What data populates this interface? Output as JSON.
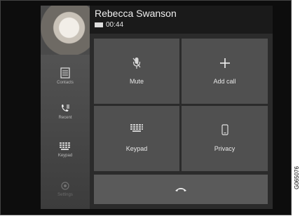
{
  "caller": {
    "name": "Rebecca Swanson",
    "call_time": "00:44"
  },
  "sidebar": {
    "items": [
      {
        "label": "Contacts",
        "icon": "contacts-icon"
      },
      {
        "label": "Recent",
        "icon": "recent-calls-icon"
      },
      {
        "label": "Keypad",
        "icon": "keypad-icon"
      },
      {
        "label": "Settings",
        "icon": "settings-icon"
      }
    ]
  },
  "actions": {
    "mute": {
      "label": "Mute",
      "icon": "microphone-muted-icon"
    },
    "add_call": {
      "label": "Add call",
      "icon": "plus-icon"
    },
    "keypad": {
      "label": "Keypad",
      "icon": "keypad-icon"
    },
    "privacy": {
      "label": "Privacy",
      "icon": "phone-handset-icon"
    },
    "hang_up": {
      "icon": "hang-up-icon"
    }
  },
  "figure_code": "G065076"
}
